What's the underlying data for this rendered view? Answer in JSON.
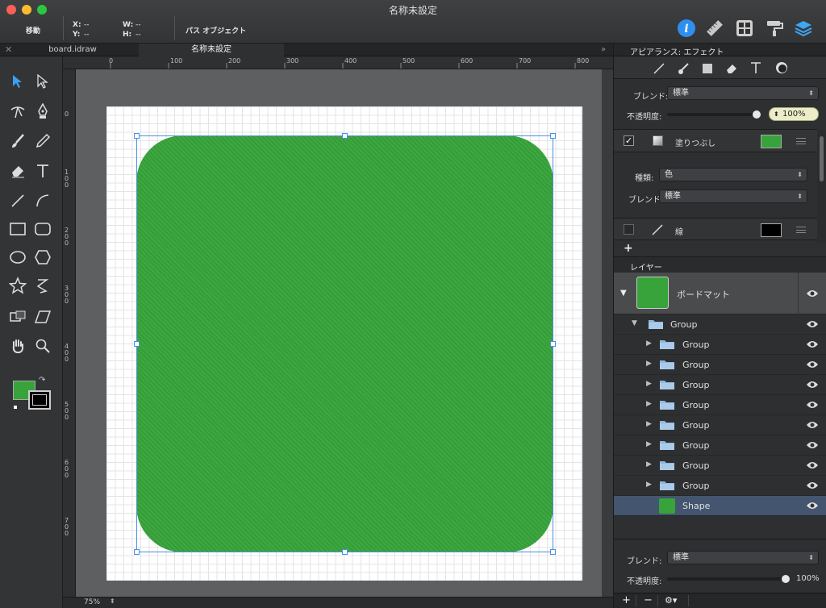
{
  "window": {
    "title": "名称未設定"
  },
  "toolbar": {
    "move_label": "移動",
    "x_label": "X:",
    "x_value": "--",
    "y_label": "Y:",
    "y_value": "--",
    "w_label": "W:",
    "w_value": "--",
    "h_label": "H:",
    "h_value": "--",
    "path_object_label": "パス オブジェクト"
  },
  "tabs": [
    {
      "label": "board.idraw"
    },
    {
      "label": "名称未設定",
      "active": true
    }
  ],
  "tab_overflow": "»",
  "ruler": {
    "top": [
      "0",
      "100",
      "200",
      "300",
      "400",
      "500",
      "600",
      "700",
      "800"
    ],
    "left": [
      "0",
      "100",
      "200",
      "300",
      "400",
      "500",
      "600",
      "700"
    ]
  },
  "canvas": {
    "shape_color": "#37a33a"
  },
  "status": {
    "zoom": "75%"
  },
  "appearance": {
    "tab_label": "アピアランス: エフェクト",
    "blend_label": "ブレンド:",
    "blend_value": "標準",
    "opacity_label": "不透明度:",
    "opacity_value": "100%",
    "fill_label": "塗りつぶし",
    "fill_color": "#37a33a",
    "fill_checked": true,
    "type_label": "種類:",
    "type_value": "色",
    "fill_blend_label": "ブレンド:",
    "fill_blend_value": "標準",
    "stroke_label": "線",
    "stroke_color": "#000000",
    "add_button": "+"
  },
  "layers": {
    "title": "レイヤー",
    "root": {
      "name": "ボードマット"
    },
    "group": {
      "name": "Group"
    },
    "children": [
      {
        "name": "Group"
      },
      {
        "name": "Group"
      },
      {
        "name": "Group"
      },
      {
        "name": "Group"
      },
      {
        "name": "Group"
      },
      {
        "name": "Group"
      },
      {
        "name": "Group"
      },
      {
        "name": "Group"
      }
    ],
    "shape": {
      "name": "Shape",
      "color": "#37a33a"
    },
    "blend_label": "ブレンド:",
    "blend_value": "標準",
    "opacity_label": "不透明度:",
    "opacity_value": "100%",
    "add_button": "+",
    "remove_button": "−",
    "gear_button": "⚙▾"
  }
}
